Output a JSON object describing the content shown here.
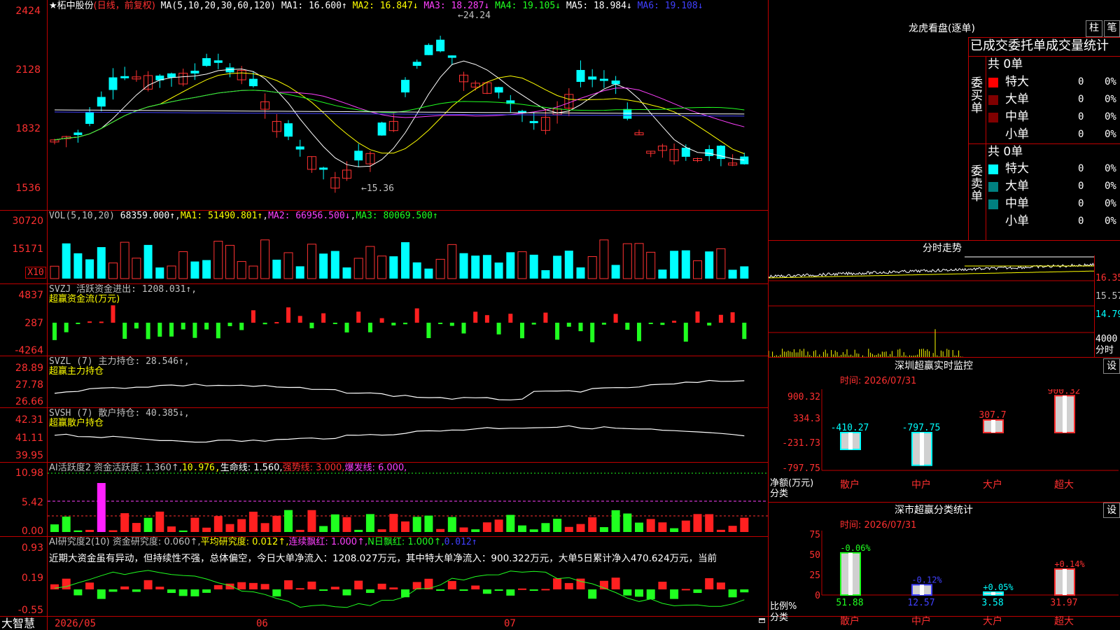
{
  "title": {
    "name": "★柘中股份",
    "mode": "(日线，前复权)",
    "ma": [
      {
        "label": "MA(5,10,20,30,60,120)",
        "color": "#ffffff"
      },
      {
        "label": "MA1: 16.600↑",
        "color": "#ffffff"
      },
      {
        "label": "MA2: 16.847↓",
        "color": "#ffff00"
      },
      {
        "label": "MA3: 18.287↓",
        "color": "#ff40ff"
      },
      {
        "label": "MA4: 19.105↓",
        "color": "#20ff20"
      },
      {
        "label": "MA5: 18.984↓",
        "color": "#ffffff"
      },
      {
        "label": "MA6: 19.108↓",
        "color": "#4040ff"
      }
    ]
  },
  "price_axis": [
    "2424",
    "2128",
    "1832",
    "1536"
  ],
  "price_marks": {
    "high": "←24.24",
    "low": "←15.36"
  },
  "vol": {
    "label": "VOL(5,10,20)",
    "value": "68359.000↑",
    "ma1": "MA1: 51490.801↑",
    "ma2": "MA2: 66956.500↓",
    "ma3": "MA3: 80069.500↑",
    "axis": [
      "30720",
      "15171"
    ],
    "unit": "X10"
  },
  "svzj": {
    "label": "SVZJ  活跃资金进出: 1208.031↑,",
    "sub": "超赢资金流(万元)",
    "axis": [
      "4837",
      "287",
      "-4264"
    ]
  },
  "svzl": {
    "label": "SVZL (7) 主力持仓: 28.546↑,",
    "sub": "超赢主力持仓",
    "axis": [
      "28.89",
      "27.78",
      "26.66"
    ]
  },
  "svsh": {
    "label": "SVSH (7) 散户持仓: 40.385↓,",
    "sub": "超赢散户持仓",
    "axis": [
      "42.31",
      "41.11",
      "39.95"
    ]
  },
  "ai1": {
    "label": "AI活跃度2 资金活跃度: 1.360↑,",
    "v2": "10.976,",
    "v3": "生命线: 1.560,",
    "v4": "强势线: 3.000,",
    "v5": "爆发线: 6.000,",
    "axis": [
      "10.98",
      "5.42",
      "0.00"
    ]
  },
  "ai2": {
    "label": "AI研究度2(10) 资金研究度: 0.060↑,",
    "v2": "平均研究度: 0.012↑,",
    "v3": "连续飘红: 1.000↑,",
    "v4": "N日飘红: 1.000↑,",
    "v5": "0.012↑",
    "text": "近期大资金虽有异动，但持续性不强，总体偏空，今日大单净流入：1208.027万元，其中特大单净流入：900.322万元，大单5日累计净入470.624万元，当前",
    "axis": [
      "0.93",
      "0.19",
      "-0.55"
    ]
  },
  "bottom": {
    "brand": "大智慧",
    "dates": [
      "2026/05",
      "06",
      "07"
    ]
  },
  "lhkp": {
    "title": "龙虎看盘(逐单)",
    "btn1": "柱",
    "btn2": "笔",
    "subtitle": "已成交委托单成交量统计",
    "buy": {
      "side": "委买单",
      "total": "共 0单",
      "rows": [
        {
          "name": "特大",
          "v": "0",
          "p": "0%",
          "c": "#ff0000"
        },
        {
          "name": "大单",
          "v": "0",
          "p": "0%",
          "c": "#800000"
        },
        {
          "name": "中单",
          "v": "0",
          "p": "0%",
          "c": "#800000"
        },
        {
          "name": "小单",
          "v": "0",
          "p": "0%",
          "c": "#000000"
        }
      ]
    },
    "sell": {
      "side": "委卖单",
      "total": "共 0单",
      "rows": [
        {
          "name": "特大",
          "v": "0",
          "p": "0%",
          "c": "#00ffff"
        },
        {
          "name": "大单",
          "v": "0",
          "p": "0%",
          "c": "#008080"
        },
        {
          "name": "中单",
          "v": "0",
          "p": "0%",
          "c": "#008080"
        },
        {
          "name": "小单",
          "v": "0",
          "p": "0%",
          "c": "#000000"
        }
      ]
    }
  },
  "fszs": {
    "title": "分时走势",
    "axis": [
      "16.35",
      "15.57",
      "14.79"
    ],
    "vol_axis": "4000",
    "vol_unit": "分时"
  },
  "szcy": {
    "title": "深圳超赢实时监控",
    "btn": "设",
    "time": "时间: 2026/07/31",
    "yaxis": [
      "900.32",
      "334.3",
      "-231.73",
      "-797.75"
    ],
    "ylabel": "净额(万元)",
    "xlabel": "分类",
    "cats": [
      "散户",
      "中户",
      "大户",
      "超大"
    ],
    "values": [
      -410.27,
      -797.75,
      307.7,
      900.32
    ],
    "labels": [
      "-410.27",
      "-797.75",
      "307.7",
      "900.32"
    ]
  },
  "sscy": {
    "title": "深市超赢分类统计",
    "btn": "设",
    "time": "时间: 2026/07/31",
    "yaxis": [
      "75",
      "50",
      "25",
      "0"
    ],
    "ylabel": "比例%",
    "xlabel": "分类",
    "cats": [
      "散户",
      "中户",
      "大户",
      "超大"
    ],
    "pct": [
      "-0.06%",
      "-0.12%",
      "+0.05%",
      "+0.14%"
    ],
    "values": [
      51.88,
      12.57,
      3.58,
      31.97
    ],
    "vlabels": [
      "51.88",
      "12.57",
      "3.58",
      "31.97"
    ]
  },
  "colors": {
    "up": "#ff3232",
    "down": "#00ffff",
    "frame": "#c00000"
  }
}
